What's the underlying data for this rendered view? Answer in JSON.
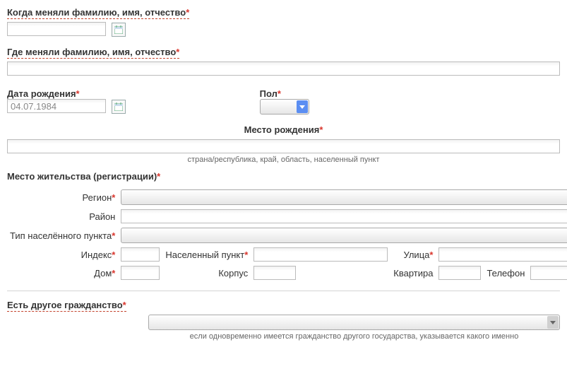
{
  "name_change_when": {
    "label": "Когда меняли фамилию, имя, отчество",
    "value": ""
  },
  "name_change_where": {
    "label": "Где меняли фамилию, имя, отчество",
    "value": ""
  },
  "dob": {
    "label": "Дата рождения",
    "value": "04.07.1984"
  },
  "gender": {
    "label": "Пол"
  },
  "birthplace": {
    "label": "Место рождения",
    "hint": "страна/республика, край, область, населенный пункт",
    "value": ""
  },
  "residence_header": "Место жительства (регистрации)",
  "addr": {
    "region": "Регион",
    "district": "Район",
    "settlement_type": "Тип населённого пункта",
    "index": "Индекс",
    "settlement": "Населенный пункт",
    "street": "Улица",
    "house": "Дом",
    "building": "Корпус",
    "flat": "Квартира",
    "phone": "Телефон"
  },
  "other_citizenship": {
    "label": "Есть другое гражданство",
    "hint": "если одновременно имеется гражданство другого государства, указывается какого именно"
  }
}
